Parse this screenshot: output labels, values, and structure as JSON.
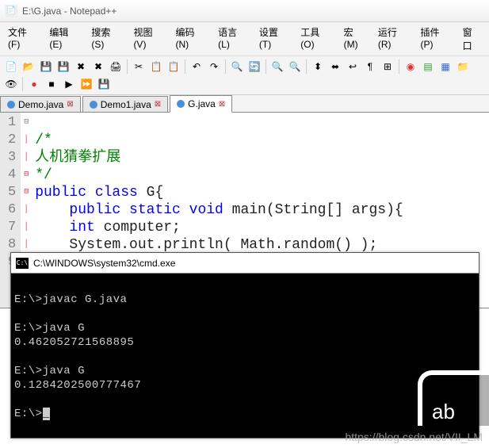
{
  "npp": {
    "title": "E:\\G.java - Notepad++",
    "menus": [
      "文件(F)",
      "编辑(E)",
      "搜索(S)",
      "视图(V)",
      "编码(N)",
      "语言(L)",
      "设置(T)",
      "工具(O)",
      "宏(M)",
      "运行(R)",
      "插件(P)",
      "窗口"
    ],
    "tabs": [
      {
        "label": "Demo.java",
        "active": false
      },
      {
        "label": "Demo1.java",
        "active": false
      },
      {
        "label": "G.java",
        "active": true
      }
    ],
    "lines": [
      {
        "num": "1",
        "text": "/*"
      },
      {
        "num": "2",
        "text": "人机猜拳扩展"
      },
      {
        "num": "3",
        "text": "*/"
      },
      {
        "num": "4",
        "a": "public class ",
        "b": "G{"
      },
      {
        "num": "5",
        "indent": "    ",
        "a": "public static void ",
        "b": "main(String[] args){"
      },
      {
        "num": "6",
        "indent": "    ",
        "a": "int ",
        "b": "computer;"
      },
      {
        "num": "7",
        "text": "    System.out.println( Math.random() );"
      },
      {
        "num": "8",
        "text": "    }"
      },
      {
        "num": "9",
        "text": "}"
      }
    ]
  },
  "cmd": {
    "title": "C:\\WINDOWS\\system32\\cmd.exe",
    "lines": [
      "",
      "E:\\>javac G.java",
      "",
      "E:\\>java G",
      "0.462052721568895",
      "",
      "E:\\>java G",
      "0.1284202500777467",
      ""
    ],
    "prompt": "E:\\>"
  },
  "overlay": {
    "text": "ab"
  },
  "watermark": "https://blog.csdn.net/VII_LM"
}
